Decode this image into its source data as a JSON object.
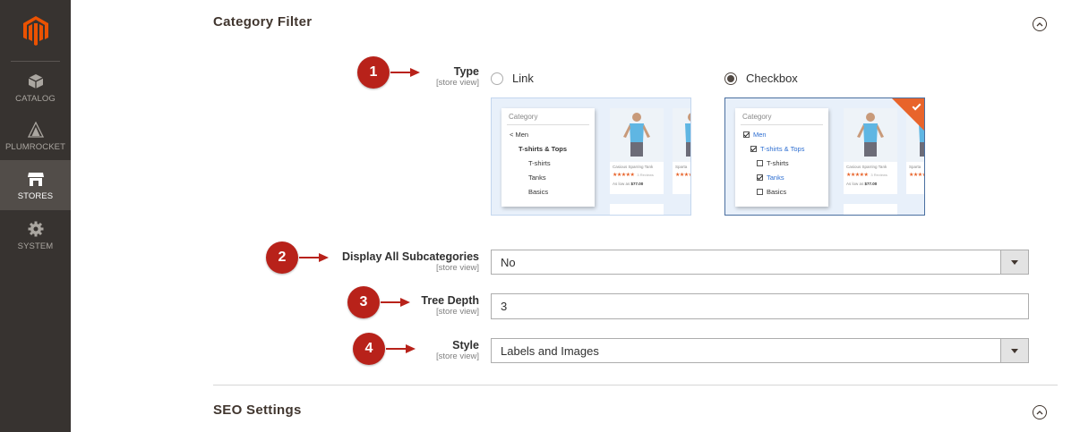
{
  "sidebar": {
    "items": [
      {
        "label": "CATALOG",
        "icon": "cube-icon"
      },
      {
        "label": "PLUMROCKET",
        "icon": "plumrocket-icon"
      },
      {
        "label": "STORES",
        "icon": "store-icon",
        "active": true
      },
      {
        "label": "SYSTEM",
        "icon": "gear-icon"
      }
    ]
  },
  "category_filter": {
    "title": "Category Filter",
    "type": {
      "label": "Type",
      "scope": "[store view]",
      "options": [
        {
          "label": "Link",
          "selected": false
        },
        {
          "label": "Checkbox",
          "selected": true
        }
      ]
    },
    "previews": {
      "link": {
        "box_title": "Category",
        "lines": [
          "< Men",
          "T-shirts & Tops",
          "T-shirts",
          "Tanks",
          "Basics"
        ]
      },
      "checkbox": {
        "box_title": "Category",
        "lines": [
          "Men",
          "T-shirts & Tops",
          "T-shirts",
          "Tanks",
          "Basics"
        ]
      },
      "product_name": "Casious Sparring Tank",
      "product_name_2": "Sparta",
      "reviews": "3 Reviews",
      "price_prefix": "As low as",
      "price": "$77.00",
      "stars": "★★★★★"
    },
    "display_all_subcategories": {
      "label": "Display All Subcategories",
      "scope": "[store view]",
      "value": "No"
    },
    "tree_depth": {
      "label": "Tree Depth",
      "scope": "[store view]",
      "value": "3"
    },
    "style": {
      "label": "Style",
      "scope": "[store view]",
      "value": "Labels and Images"
    }
  },
  "seo_settings": {
    "title": "SEO Settings"
  },
  "markers": [
    "1",
    "2",
    "3",
    "4"
  ],
  "colors": {
    "sidebar": "#373330",
    "sidebar_active": "#524d49",
    "marker": "#b8221a",
    "brand": "#eb5202",
    "accent": "#e8642b"
  }
}
